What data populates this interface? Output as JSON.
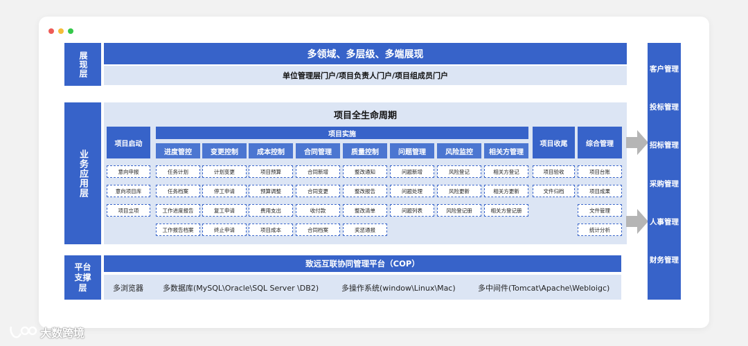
{
  "presentation": {
    "label": "展现层",
    "banner": "多领域、多层级、多端展现",
    "portals": "单位管理层门户/项目负责人门户/项目组成员门户"
  },
  "business": {
    "label": "业务应用层",
    "title": "项目全生命周期",
    "start": {
      "head": "项目启动",
      "items": [
        "意向申报",
        "意向项目库",
        "项目立项"
      ]
    },
    "impl": {
      "head": "项目实施",
      "columns": [
        {
          "head": "进度管控",
          "items": [
            "任务计划",
            "任务档案",
            "工作进度报告",
            "工作报告档案"
          ]
        },
        {
          "head": "变更控制",
          "items": [
            "计划变更",
            "停工申请",
            "复工申请",
            "终止申请"
          ]
        },
        {
          "head": "成本控制",
          "items": [
            "项目预算",
            "预算调整",
            "费用支出",
            "项目成本"
          ]
        },
        {
          "head": "合同管理",
          "items": [
            "合同新增",
            "合同变更",
            "收付款",
            "合同档案"
          ]
        },
        {
          "head": "质量控制",
          "items": [
            "整改通知",
            "整改报告",
            "整改清单",
            "奖惩通报"
          ]
        },
        {
          "head": "问题管理",
          "items": [
            "问题新增",
            "问题处理",
            "问题列表"
          ]
        },
        {
          "head": "风险监控",
          "items": [
            "风险登记",
            "风险更新",
            "风险登记册"
          ]
        },
        {
          "head": "相关方管理",
          "items": [
            "相关方登记",
            "相关方更新",
            "相关方登记册"
          ]
        }
      ]
    },
    "closing": {
      "head": "项目收尾",
      "items": [
        "项目验收",
        "文件归档"
      ]
    },
    "general": {
      "head": "综合管理",
      "items": [
        "项目台账",
        "项目成果",
        "文件管理",
        "统计分析"
      ]
    }
  },
  "platform": {
    "label": "平台支撑层",
    "banner": "致远互联协同管理平台（COP）",
    "items": [
      "多浏览器",
      "多数据库(MySQL\\Oracle\\SQL Server \\DB2)",
      "多操作系统(window\\Linux\\Mac)",
      "多中间件(Tomcat\\Apache\\Webloigc)"
    ]
  },
  "right": [
    "客户管理",
    "投标管理",
    "招标管理",
    "采购管理",
    "人事管理",
    "财务管理"
  ],
  "watermark": "大数跨境",
  "colors": {
    "primary": "#3763c9",
    "light": "#dce5f4",
    "arrow": "#b5b5b5"
  }
}
